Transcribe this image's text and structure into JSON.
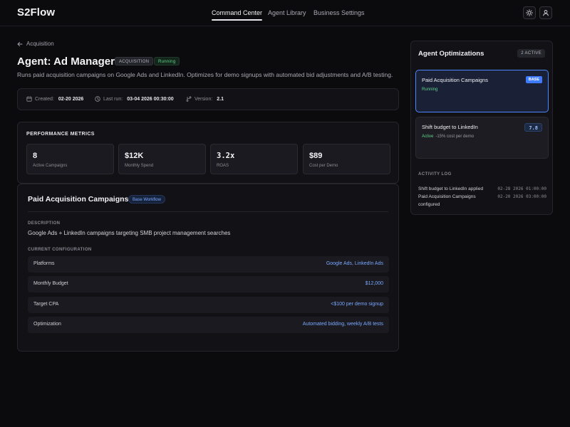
{
  "app": {
    "logo": "S2Flow"
  },
  "nav": [
    {
      "label": "Command Center",
      "active": true
    },
    {
      "label": "Agent Library",
      "active": false
    },
    {
      "label": "Business Settings",
      "active": false
    }
  ],
  "header_icons": [
    "sun-icon",
    "user-icon"
  ],
  "breadcrumb": {
    "label": "Acquisition"
  },
  "agent": {
    "title": "Agent: Ad Manager",
    "tag": "ACQUISITION",
    "status": "Running",
    "description": "Runs paid acquisition campaigns on Google Ads and LinkedIn. Optimizes for demo signups with automated bid adjustments and A/B testing."
  },
  "meta": {
    "created_label": "Created:",
    "created_value": "02-20 2026",
    "lastrun_label": "Last run:",
    "lastrun_value": "03-04 2026 00:30:00",
    "version_label": "Version:",
    "version_value": "2.1"
  },
  "performance": {
    "title": "PERFORMANCE METRICS",
    "metrics": [
      {
        "value": "8",
        "label": "Active Campaigns"
      },
      {
        "value": "$12K",
        "label": "Monthly Spend"
      },
      {
        "value": "3.2x",
        "label": "ROAS"
      },
      {
        "value": "$89",
        "label": "Cost per Demo"
      }
    ]
  },
  "workflow": {
    "title": "Paid Acquisition Campaigns",
    "badge": "Base Workflow",
    "description_heading": "DESCRIPTION",
    "description": "Google Ads + LinkedIn campaigns targeting SMB project management searches",
    "config_heading": "CURRENT CONFIGURATION",
    "config": [
      {
        "key": "Platforms",
        "value": "Google Ads, LinkedIn Ads"
      },
      {
        "key": "Monthly Budget",
        "value": "$12,000"
      },
      {
        "key": "Target CPA",
        "value": "<$100 per demo signup"
      },
      {
        "key": "Optimization",
        "value": "Automated bidding, weekly A/B tests"
      }
    ]
  },
  "optimizations": {
    "title": "Agent Optimizations",
    "count": "2 ACTIVE",
    "items": [
      {
        "name": "Paid Acquisition Campaigns",
        "badge": "BASE",
        "status": "Running",
        "detail": ""
      },
      {
        "name": "Shift budget to LinkedIn",
        "badge": "7.8",
        "status": "Active",
        "detail": "-15% cost per demo"
      }
    ],
    "log_heading": "ACTIVITY LOG",
    "log": [
      {
        "text": "Shift budget to LinkedIn applied",
        "time": "02-28 2026 01:00:00"
      },
      {
        "text": "Paid Acquisition Campaigns configured",
        "time": "02-20 2026 03:00:00"
      }
    ]
  },
  "colors": {
    "accent": "#4d86ff",
    "success": "#5fd38b",
    "background": "#0b0b0e"
  }
}
